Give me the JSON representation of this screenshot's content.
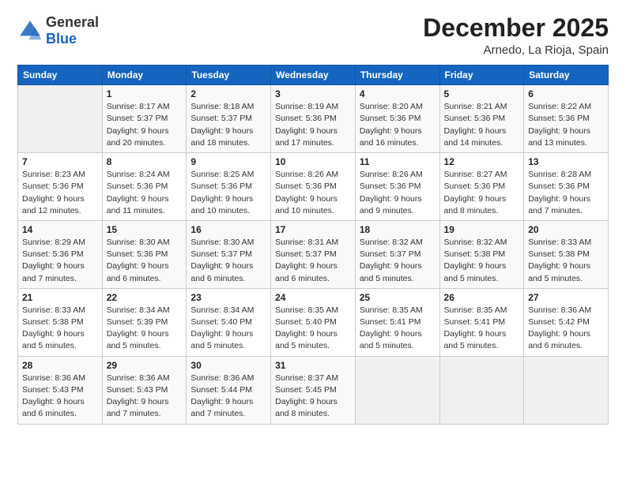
{
  "header": {
    "logo_general": "General",
    "logo_blue": "Blue",
    "month": "December 2025",
    "location": "Arnedo, La Rioja, Spain"
  },
  "weekdays": [
    "Sunday",
    "Monday",
    "Tuesday",
    "Wednesday",
    "Thursday",
    "Friday",
    "Saturday"
  ],
  "weeks": [
    [
      {
        "day": "",
        "info": ""
      },
      {
        "day": "1",
        "info": "Sunrise: 8:17 AM\nSunset: 5:37 PM\nDaylight: 9 hours\nand 20 minutes."
      },
      {
        "day": "2",
        "info": "Sunrise: 8:18 AM\nSunset: 5:37 PM\nDaylight: 9 hours\nand 18 minutes."
      },
      {
        "day": "3",
        "info": "Sunrise: 8:19 AM\nSunset: 5:36 PM\nDaylight: 9 hours\nand 17 minutes."
      },
      {
        "day": "4",
        "info": "Sunrise: 8:20 AM\nSunset: 5:36 PM\nDaylight: 9 hours\nand 16 minutes."
      },
      {
        "day": "5",
        "info": "Sunrise: 8:21 AM\nSunset: 5:36 PM\nDaylight: 9 hours\nand 14 minutes."
      },
      {
        "day": "6",
        "info": "Sunrise: 8:22 AM\nSunset: 5:36 PM\nDaylight: 9 hours\nand 13 minutes."
      }
    ],
    [
      {
        "day": "7",
        "info": "Sunrise: 8:23 AM\nSunset: 5:36 PM\nDaylight: 9 hours\nand 12 minutes."
      },
      {
        "day": "8",
        "info": "Sunrise: 8:24 AM\nSunset: 5:36 PM\nDaylight: 9 hours\nand 11 minutes."
      },
      {
        "day": "9",
        "info": "Sunrise: 8:25 AM\nSunset: 5:36 PM\nDaylight: 9 hours\nand 10 minutes."
      },
      {
        "day": "10",
        "info": "Sunrise: 8:26 AM\nSunset: 5:36 PM\nDaylight: 9 hours\nand 10 minutes."
      },
      {
        "day": "11",
        "info": "Sunrise: 8:26 AM\nSunset: 5:36 PM\nDaylight: 9 hours\nand 9 minutes."
      },
      {
        "day": "12",
        "info": "Sunrise: 8:27 AM\nSunset: 5:36 PM\nDaylight: 9 hours\nand 8 minutes."
      },
      {
        "day": "13",
        "info": "Sunrise: 8:28 AM\nSunset: 5:36 PM\nDaylight: 9 hours\nand 7 minutes."
      }
    ],
    [
      {
        "day": "14",
        "info": "Sunrise: 8:29 AM\nSunset: 5:36 PM\nDaylight: 9 hours\nand 7 minutes."
      },
      {
        "day": "15",
        "info": "Sunrise: 8:30 AM\nSunset: 5:36 PM\nDaylight: 9 hours\nand 6 minutes."
      },
      {
        "day": "16",
        "info": "Sunrise: 8:30 AM\nSunset: 5:37 PM\nDaylight: 9 hours\nand 6 minutes."
      },
      {
        "day": "17",
        "info": "Sunrise: 8:31 AM\nSunset: 5:37 PM\nDaylight: 9 hours\nand 6 minutes."
      },
      {
        "day": "18",
        "info": "Sunrise: 8:32 AM\nSunset: 5:37 PM\nDaylight: 9 hours\nand 5 minutes."
      },
      {
        "day": "19",
        "info": "Sunrise: 8:32 AM\nSunset: 5:38 PM\nDaylight: 9 hours\nand 5 minutes."
      },
      {
        "day": "20",
        "info": "Sunrise: 8:33 AM\nSunset: 5:38 PM\nDaylight: 9 hours\nand 5 minutes."
      }
    ],
    [
      {
        "day": "21",
        "info": "Sunrise: 8:33 AM\nSunset: 5:38 PM\nDaylight: 9 hours\nand 5 minutes."
      },
      {
        "day": "22",
        "info": "Sunrise: 8:34 AM\nSunset: 5:39 PM\nDaylight: 9 hours\nand 5 minutes."
      },
      {
        "day": "23",
        "info": "Sunrise: 8:34 AM\nSunset: 5:40 PM\nDaylight: 9 hours\nand 5 minutes."
      },
      {
        "day": "24",
        "info": "Sunrise: 8:35 AM\nSunset: 5:40 PM\nDaylight: 9 hours\nand 5 minutes."
      },
      {
        "day": "25",
        "info": "Sunrise: 8:35 AM\nSunset: 5:41 PM\nDaylight: 9 hours\nand 5 minutes."
      },
      {
        "day": "26",
        "info": "Sunrise: 8:35 AM\nSunset: 5:41 PM\nDaylight: 9 hours\nand 5 minutes."
      },
      {
        "day": "27",
        "info": "Sunrise: 8:36 AM\nSunset: 5:42 PM\nDaylight: 9 hours\nand 6 minutes."
      }
    ],
    [
      {
        "day": "28",
        "info": "Sunrise: 8:36 AM\nSunset: 5:43 PM\nDaylight: 9 hours\nand 6 minutes."
      },
      {
        "day": "29",
        "info": "Sunrise: 8:36 AM\nSunset: 5:43 PM\nDaylight: 9 hours\nand 7 minutes."
      },
      {
        "day": "30",
        "info": "Sunrise: 8:36 AM\nSunset: 5:44 PM\nDaylight: 9 hours\nand 7 minutes."
      },
      {
        "day": "31",
        "info": "Sunrise: 8:37 AM\nSunset: 5:45 PM\nDaylight: 9 hours\nand 8 minutes."
      },
      {
        "day": "",
        "info": ""
      },
      {
        "day": "",
        "info": ""
      },
      {
        "day": "",
        "info": ""
      }
    ]
  ]
}
